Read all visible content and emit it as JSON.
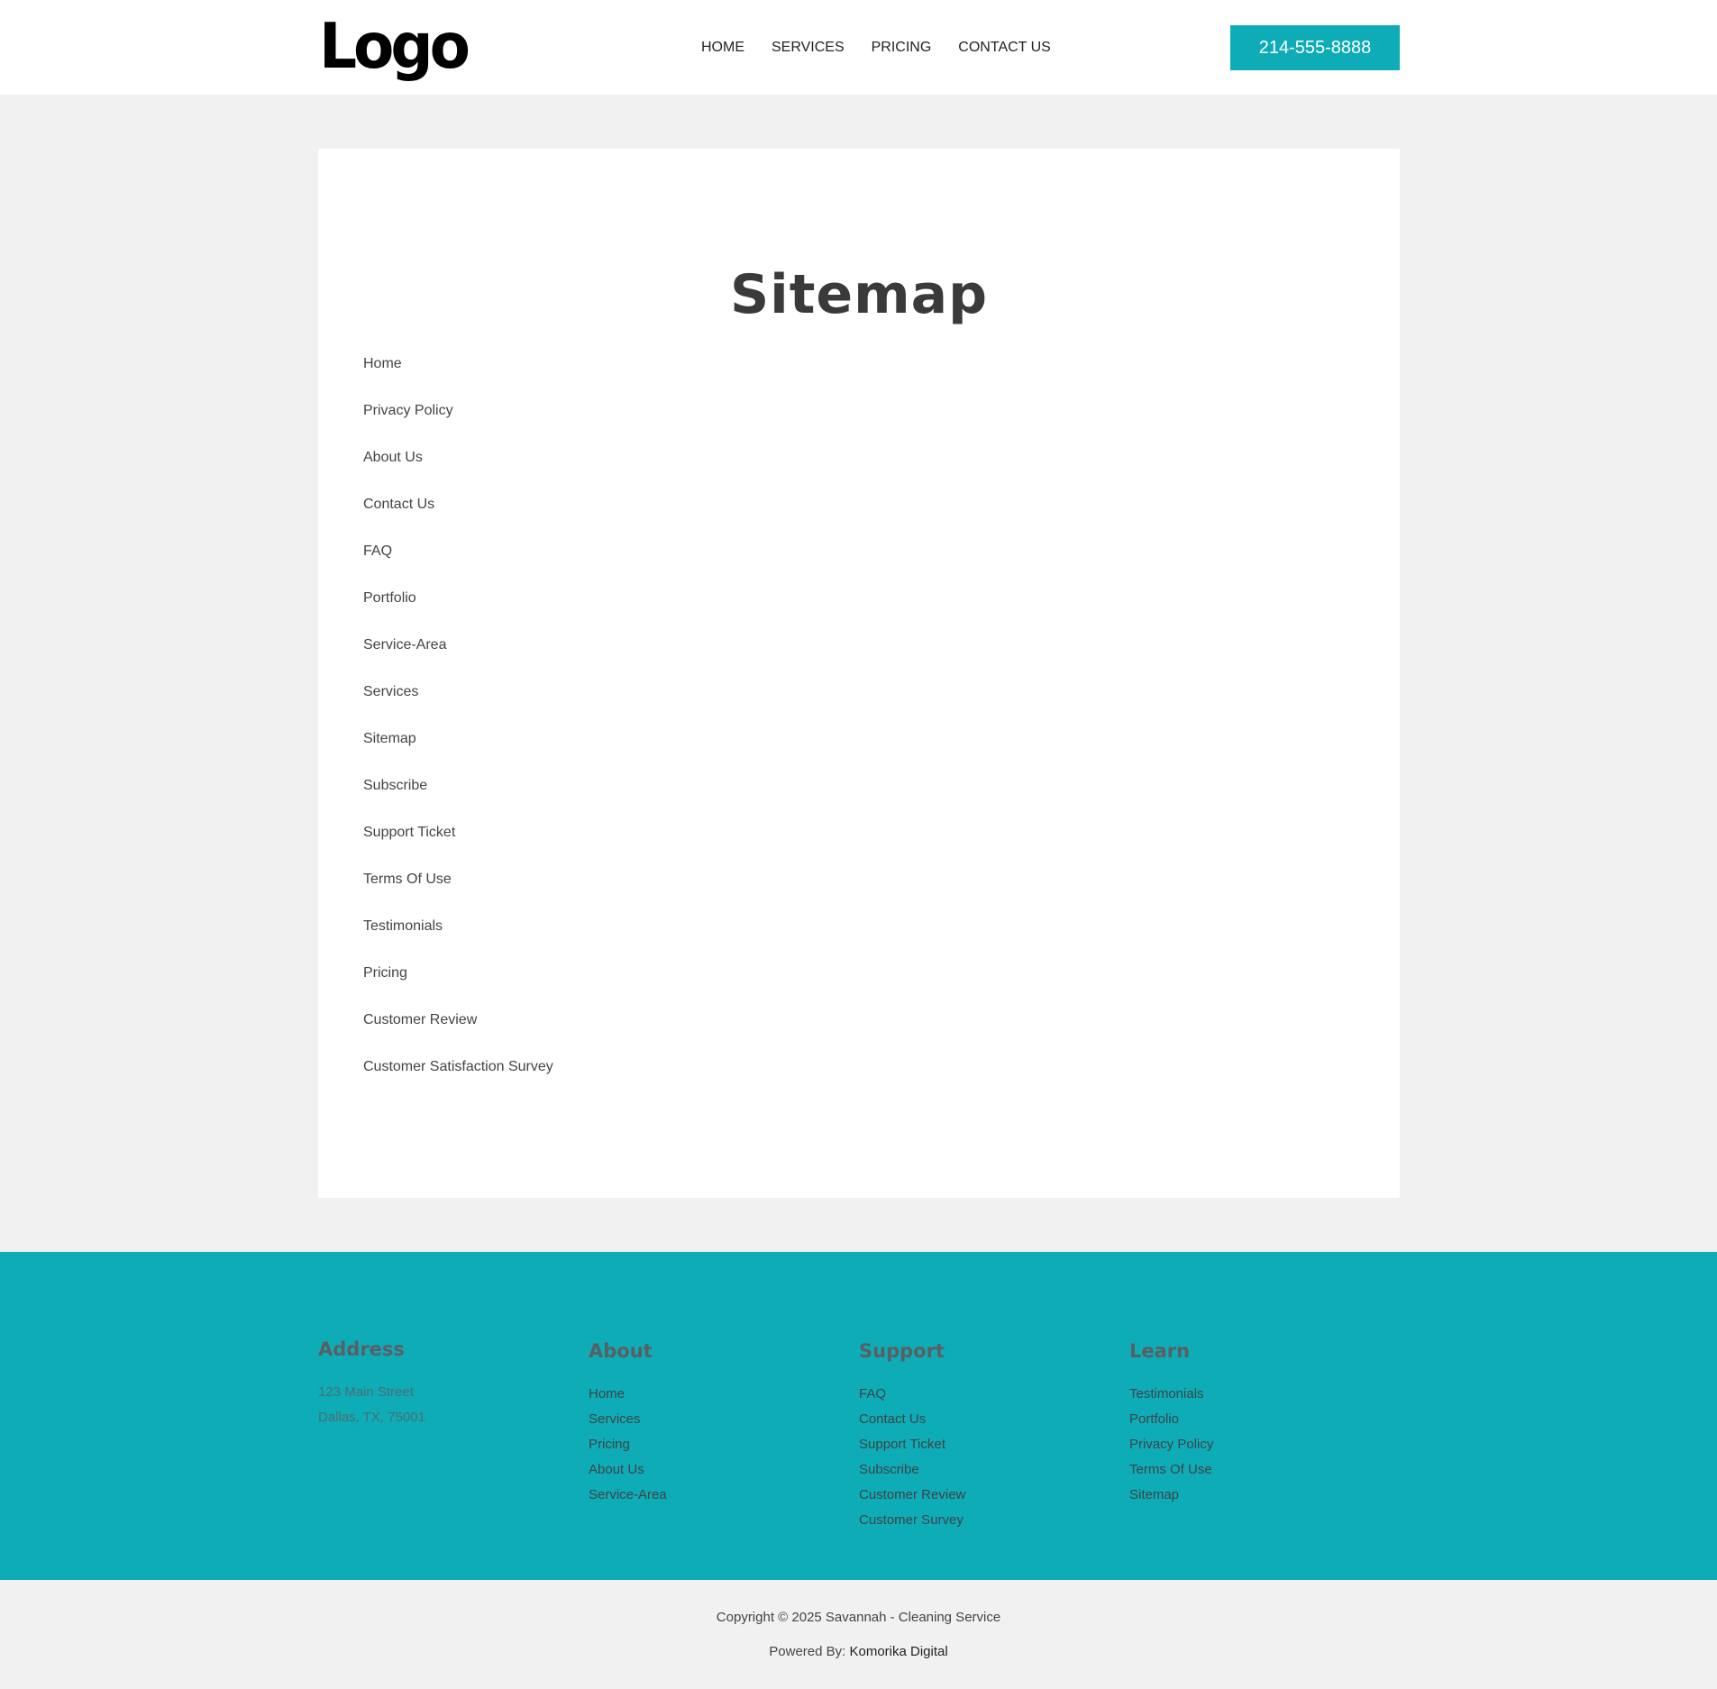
{
  "header": {
    "logo": "Logo",
    "nav": [
      "HOME",
      "SERVICES",
      "PRICING",
      "CONTACT US"
    ],
    "phone": "214-555-8888"
  },
  "main": {
    "title": "Sitemap",
    "links": [
      "Home",
      "Privacy Policy",
      "About Us",
      "Contact Us",
      "FAQ",
      "Portfolio",
      "Service-Area",
      "Services",
      "Sitemap",
      "Subscribe",
      "Support Ticket",
      "Terms Of Use",
      "Testimonials",
      "Pricing",
      "Customer Review",
      "Customer Satisfaction Survey"
    ]
  },
  "footer": {
    "address": {
      "heading": "Address",
      "line1": "123 Main Street",
      "line2": "Dallas, TX, 75001"
    },
    "about": {
      "heading": "About",
      "links": [
        "Home",
        "Services",
        "Pricing",
        "About Us",
        "Service-Area"
      ]
    },
    "support": {
      "heading": "Support",
      "links": [
        "FAQ",
        "Contact Us",
        "Support Ticket",
        "Subscribe",
        "Customer Review",
        "Customer Survey"
      ]
    },
    "learn": {
      "heading": "Learn",
      "links": [
        "Testimonials",
        "Portfolio",
        "Privacy Policy",
        "Terms Of Use",
        "Sitemap"
      ]
    }
  },
  "bottom": {
    "copyright": "Copyright © 2025 Savannah - Cleaning Service",
    "powered_label": "Powered By: ",
    "powered_link": "Komorika Digital"
  },
  "colors": {
    "accent": "#0eacb7",
    "background": "#f1f1f1"
  }
}
